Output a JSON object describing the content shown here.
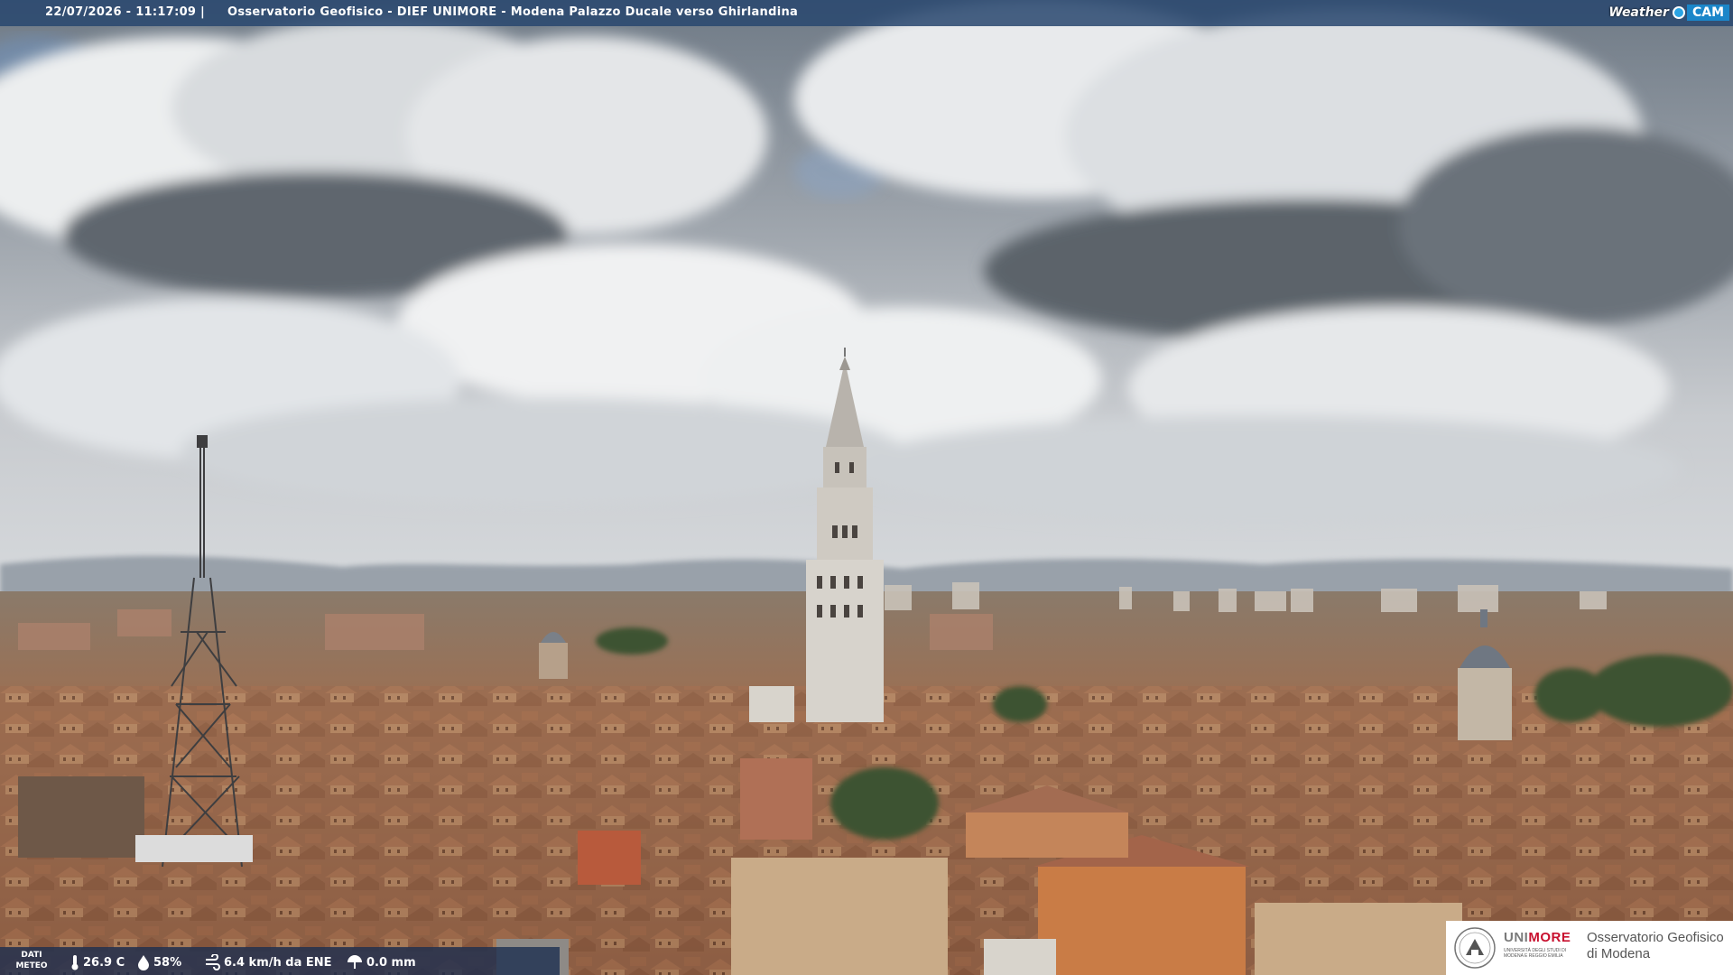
{
  "header": {
    "timestamp": "22/07/2026 - 11:17:09",
    "separator": "|",
    "caption": "Osservatorio Geofisico - DIEF UNIMORE - Modena Palazzo Ducale verso Ghirlandina"
  },
  "weathercam_logo": {
    "word": "Weather",
    "cam": "CAM"
  },
  "weather_data": {
    "label_line1": "DATI",
    "label_line2": "METEO",
    "temperature": "26.9 C",
    "humidity": "58%",
    "wind": "6.4 km/h da ENE",
    "rain": "0.0 mm"
  },
  "institution_logo": {
    "uni_prefix": "UNI",
    "uni_suffix": "MORE",
    "uni_subtitle": "UNIVERSITÀ DEGLI STUDI DI MODENA E REGGIO EMILIA",
    "observatory_line1": "Osservatorio Geofisico",
    "observatory_line2": "di Modena"
  },
  "icons": [
    "thermometer-icon",
    "humidity-drop-icon",
    "wind-icon",
    "rain-icon",
    "unimore-emblem-icon",
    "weathercam-dot-icon"
  ],
  "colors": {
    "top_bar": "#28466e",
    "bottom_bar": "#192d50",
    "cam_blue": "#1b86c9",
    "more_red": "#c8102e"
  }
}
